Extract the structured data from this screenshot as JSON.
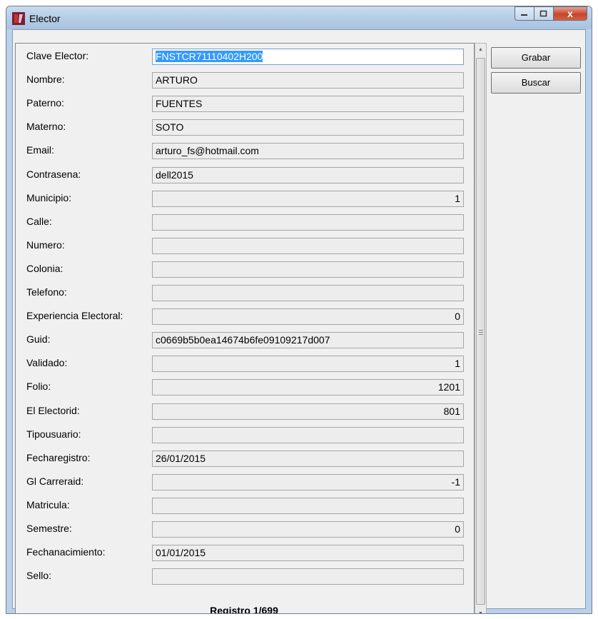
{
  "window": {
    "title": "Elector",
    "close_glyph": "x"
  },
  "fields": [
    {
      "label": "Clave Elector:",
      "value": "FNSTCR71110402H200",
      "align": "left",
      "selected": true
    },
    {
      "label": "Nombre:",
      "value": "ARTURO",
      "align": "left"
    },
    {
      "label": "Paterno:",
      "value": "FUENTES",
      "align": "left"
    },
    {
      "label": "Materno:",
      "value": "SOTO",
      "align": "left"
    },
    {
      "label": "Email:",
      "value": "arturo_fs@hotmail.com",
      "align": "left"
    },
    {
      "label": "Contrasena:",
      "value": "dell2015",
      "align": "left"
    },
    {
      "label": "Municipio:",
      "value": "1",
      "align": "right"
    },
    {
      "label": "Calle:",
      "value": "",
      "align": "left"
    },
    {
      "label": "Numero:",
      "value": "",
      "align": "left"
    },
    {
      "label": "Colonia:",
      "value": "",
      "align": "left"
    },
    {
      "label": "Telefono:",
      "value": "",
      "align": "left"
    },
    {
      "label": "Experiencia Electoral:",
      "value": "0",
      "align": "right"
    },
    {
      "label": "Guid:",
      "value": "c0669b5b0ea14674b6fe09109217d007",
      "align": "left"
    },
    {
      "label": "Validado:",
      "value": "1",
      "align": "right"
    },
    {
      "label": "Folio:",
      "value": "1201",
      "align": "right"
    },
    {
      "label": "El Electorid:",
      "value": "801",
      "align": "right"
    },
    {
      "label": "Tipousuario:",
      "value": "",
      "align": "left"
    },
    {
      "label": "Fecharegistro:",
      "value": "26/01/2015",
      "align": "left"
    },
    {
      "label": "Gl Carreraid:",
      "value": "-1",
      "align": "right"
    },
    {
      "label": "Matricula:",
      "value": "",
      "align": "left"
    },
    {
      "label": "Semestre:",
      "value": "0",
      "align": "right"
    },
    {
      "label": "Fechanacimiento:",
      "value": "01/01/2015",
      "align": "left"
    },
    {
      "label": "Sello:",
      "value": "",
      "align": "left"
    }
  ],
  "footer": {
    "record_text": "Registro 1/699"
  },
  "buttons": {
    "save": "Grabar",
    "search": "Buscar"
  }
}
